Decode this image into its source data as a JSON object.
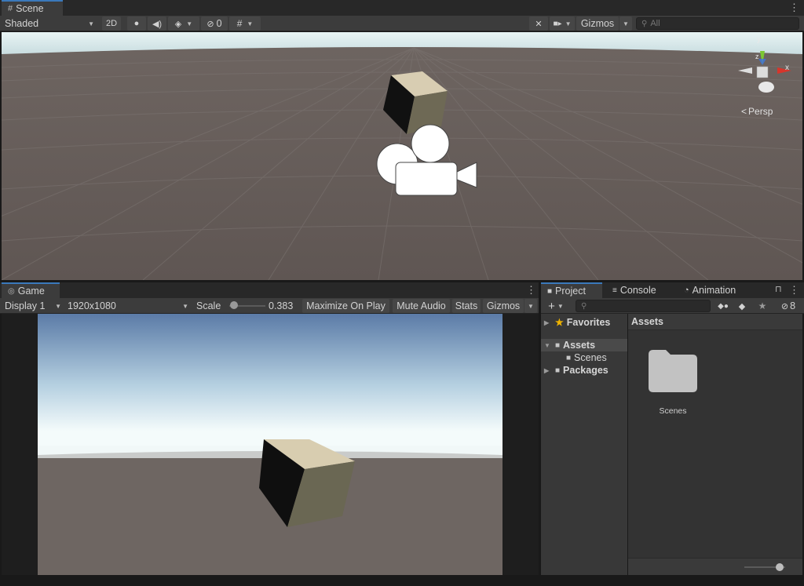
{
  "scene": {
    "tab_label": "Scene",
    "shading_mode": "Shaded",
    "mode_2d": "2D",
    "hidden_count": "0",
    "gizmos_label": "Gizmos",
    "search_placeholder": "All",
    "persp_label": "Persp",
    "axis_y": "y",
    "axis_x": "x",
    "axis_z": "z"
  },
  "game": {
    "tab_label": "Game",
    "display": "Display 1",
    "resolution": "1920x1080",
    "scale_label": "Scale",
    "scale_value": "0.383",
    "scale_fraction": 0.02,
    "maximize_label": "Maximize On Play",
    "mute_label": "Mute Audio",
    "stats_label": "Stats",
    "gizmos_label": "Gizmos"
  },
  "project": {
    "tabs": [
      {
        "label": "Project"
      },
      {
        "label": "Console"
      },
      {
        "label": "Animation"
      }
    ],
    "hidden_count": "8",
    "tree": [
      {
        "label": "Favorites"
      },
      {
        "label": "Assets"
      },
      {
        "label": "Scenes"
      },
      {
        "label": "Packages"
      }
    ],
    "breadcrumb": "Assets",
    "items": [
      {
        "label": "Scenes"
      }
    ],
    "zoom_fraction": 0.95
  },
  "colors": {
    "accent": "#3a79bb",
    "panel": "#3c3c3c",
    "favorites_star": "#f0b400",
    "axis_x": "#d8352b",
    "axis_y": "#7cc832",
    "axis_z": "#3f76dd"
  }
}
